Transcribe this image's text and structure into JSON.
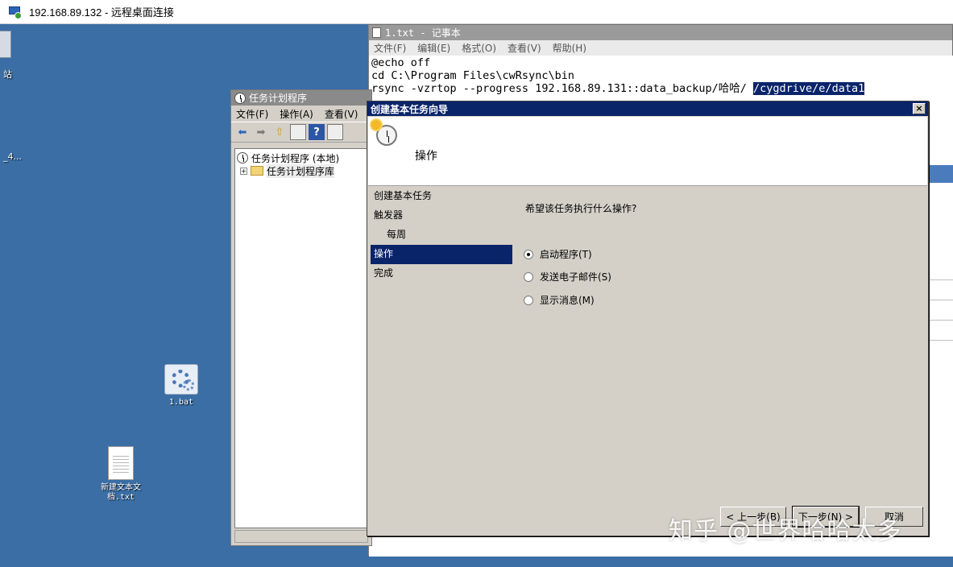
{
  "rdp": {
    "title": "192.168.89.132 - 远程桌面连接"
  },
  "desktop": {
    "edge_label_top": "站",
    "edge_label_mid": "_4...",
    "icons": [
      {
        "label": "1.bat"
      },
      {
        "label": "新建文本文\n档.txt"
      }
    ]
  },
  "notepad": {
    "title": "1.txt - 记事本",
    "menu": [
      "文件(F)",
      "编辑(E)",
      "格式(O)",
      "查看(V)",
      "帮助(H)"
    ],
    "lines": [
      "@echo off",
      "cd C:\\Program Files\\cwRsync\\bin",
      "rsync -vzrtop --progress 192.168.89.131::data_backup/哈哈/ "
    ],
    "selected_text": "/cygdrive/e/data1"
  },
  "task_scheduler": {
    "title": "任务计划程序",
    "menu": [
      "文件(F)",
      "操作(A)",
      "查看(V)"
    ],
    "tree": [
      {
        "label": "任务计划程序 (本地)"
      },
      {
        "label": "任务计划程序库"
      }
    ],
    "expander": "+"
  },
  "wizard": {
    "title": "创建基本任务向导",
    "close": "×",
    "header_title": "操作",
    "steps": [
      {
        "label": "创建基本任务"
      },
      {
        "label": "触发器"
      },
      {
        "label": "每周"
      },
      {
        "label": "操作"
      },
      {
        "label": "完成"
      }
    ],
    "question": "希望该任务执行什么操作?",
    "options": [
      {
        "label": "启动程序(T)",
        "checked": true
      },
      {
        "label": "发送电子邮件(S)",
        "checked": false
      },
      {
        "label": "显示消息(M)",
        "checked": false
      }
    ],
    "buttons": {
      "back": "< 上一步(B)",
      "next": "下一步(N) >",
      "cancel": "取消"
    }
  },
  "watermark": "知乎 @世界哈哈太多"
}
